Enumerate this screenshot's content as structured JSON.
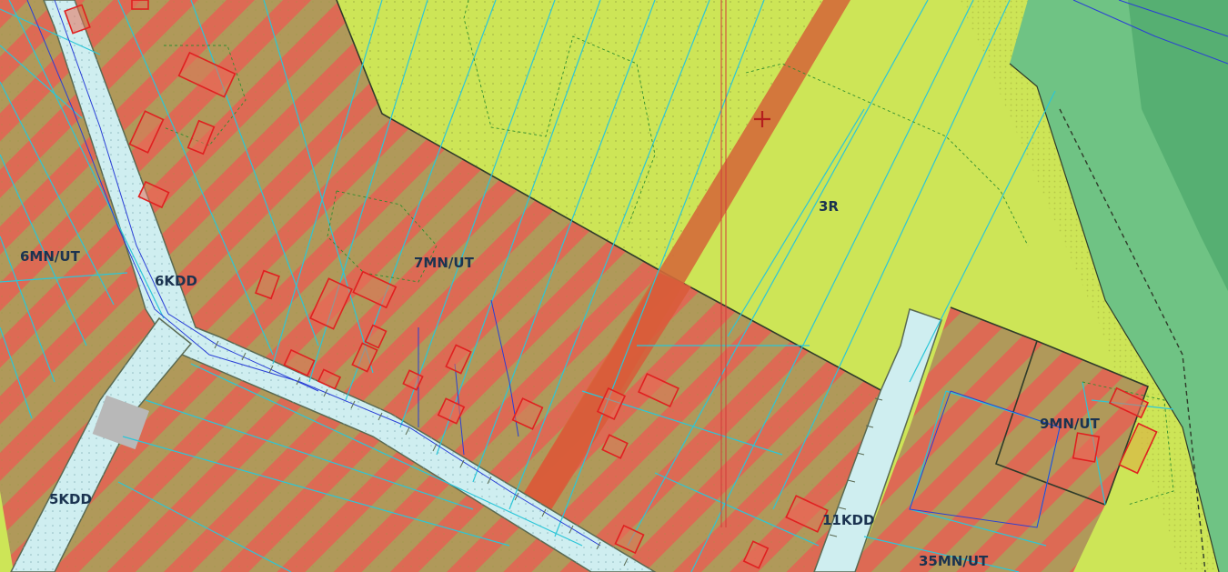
{
  "map": {
    "colors": {
      "agri_yellow": "#cde557",
      "residential_stripe_red": "#dd6a54",
      "residential_stripe_tan": "#b0995a",
      "road_fill": "#cfeef0",
      "forest_green": "#6fc384",
      "forest_dark": "#52ab6e",
      "corridor_orange": "#d46a3a",
      "building_red": "#e04545",
      "parcel_cyan": "#2bc6d8",
      "network_blue": "#2a3fd6",
      "boundary_dark": "#2f3b2a"
    },
    "zone_labels": {
      "z1": "6MN/UT",
      "z2": "7MN/UT",
      "z3": "3R",
      "z4": "9MN/UT",
      "z5": "35MN/UT"
    },
    "road_labels": {
      "r1": "6KDD",
      "r2": "5KDD",
      "r3": "11KDD"
    }
  }
}
